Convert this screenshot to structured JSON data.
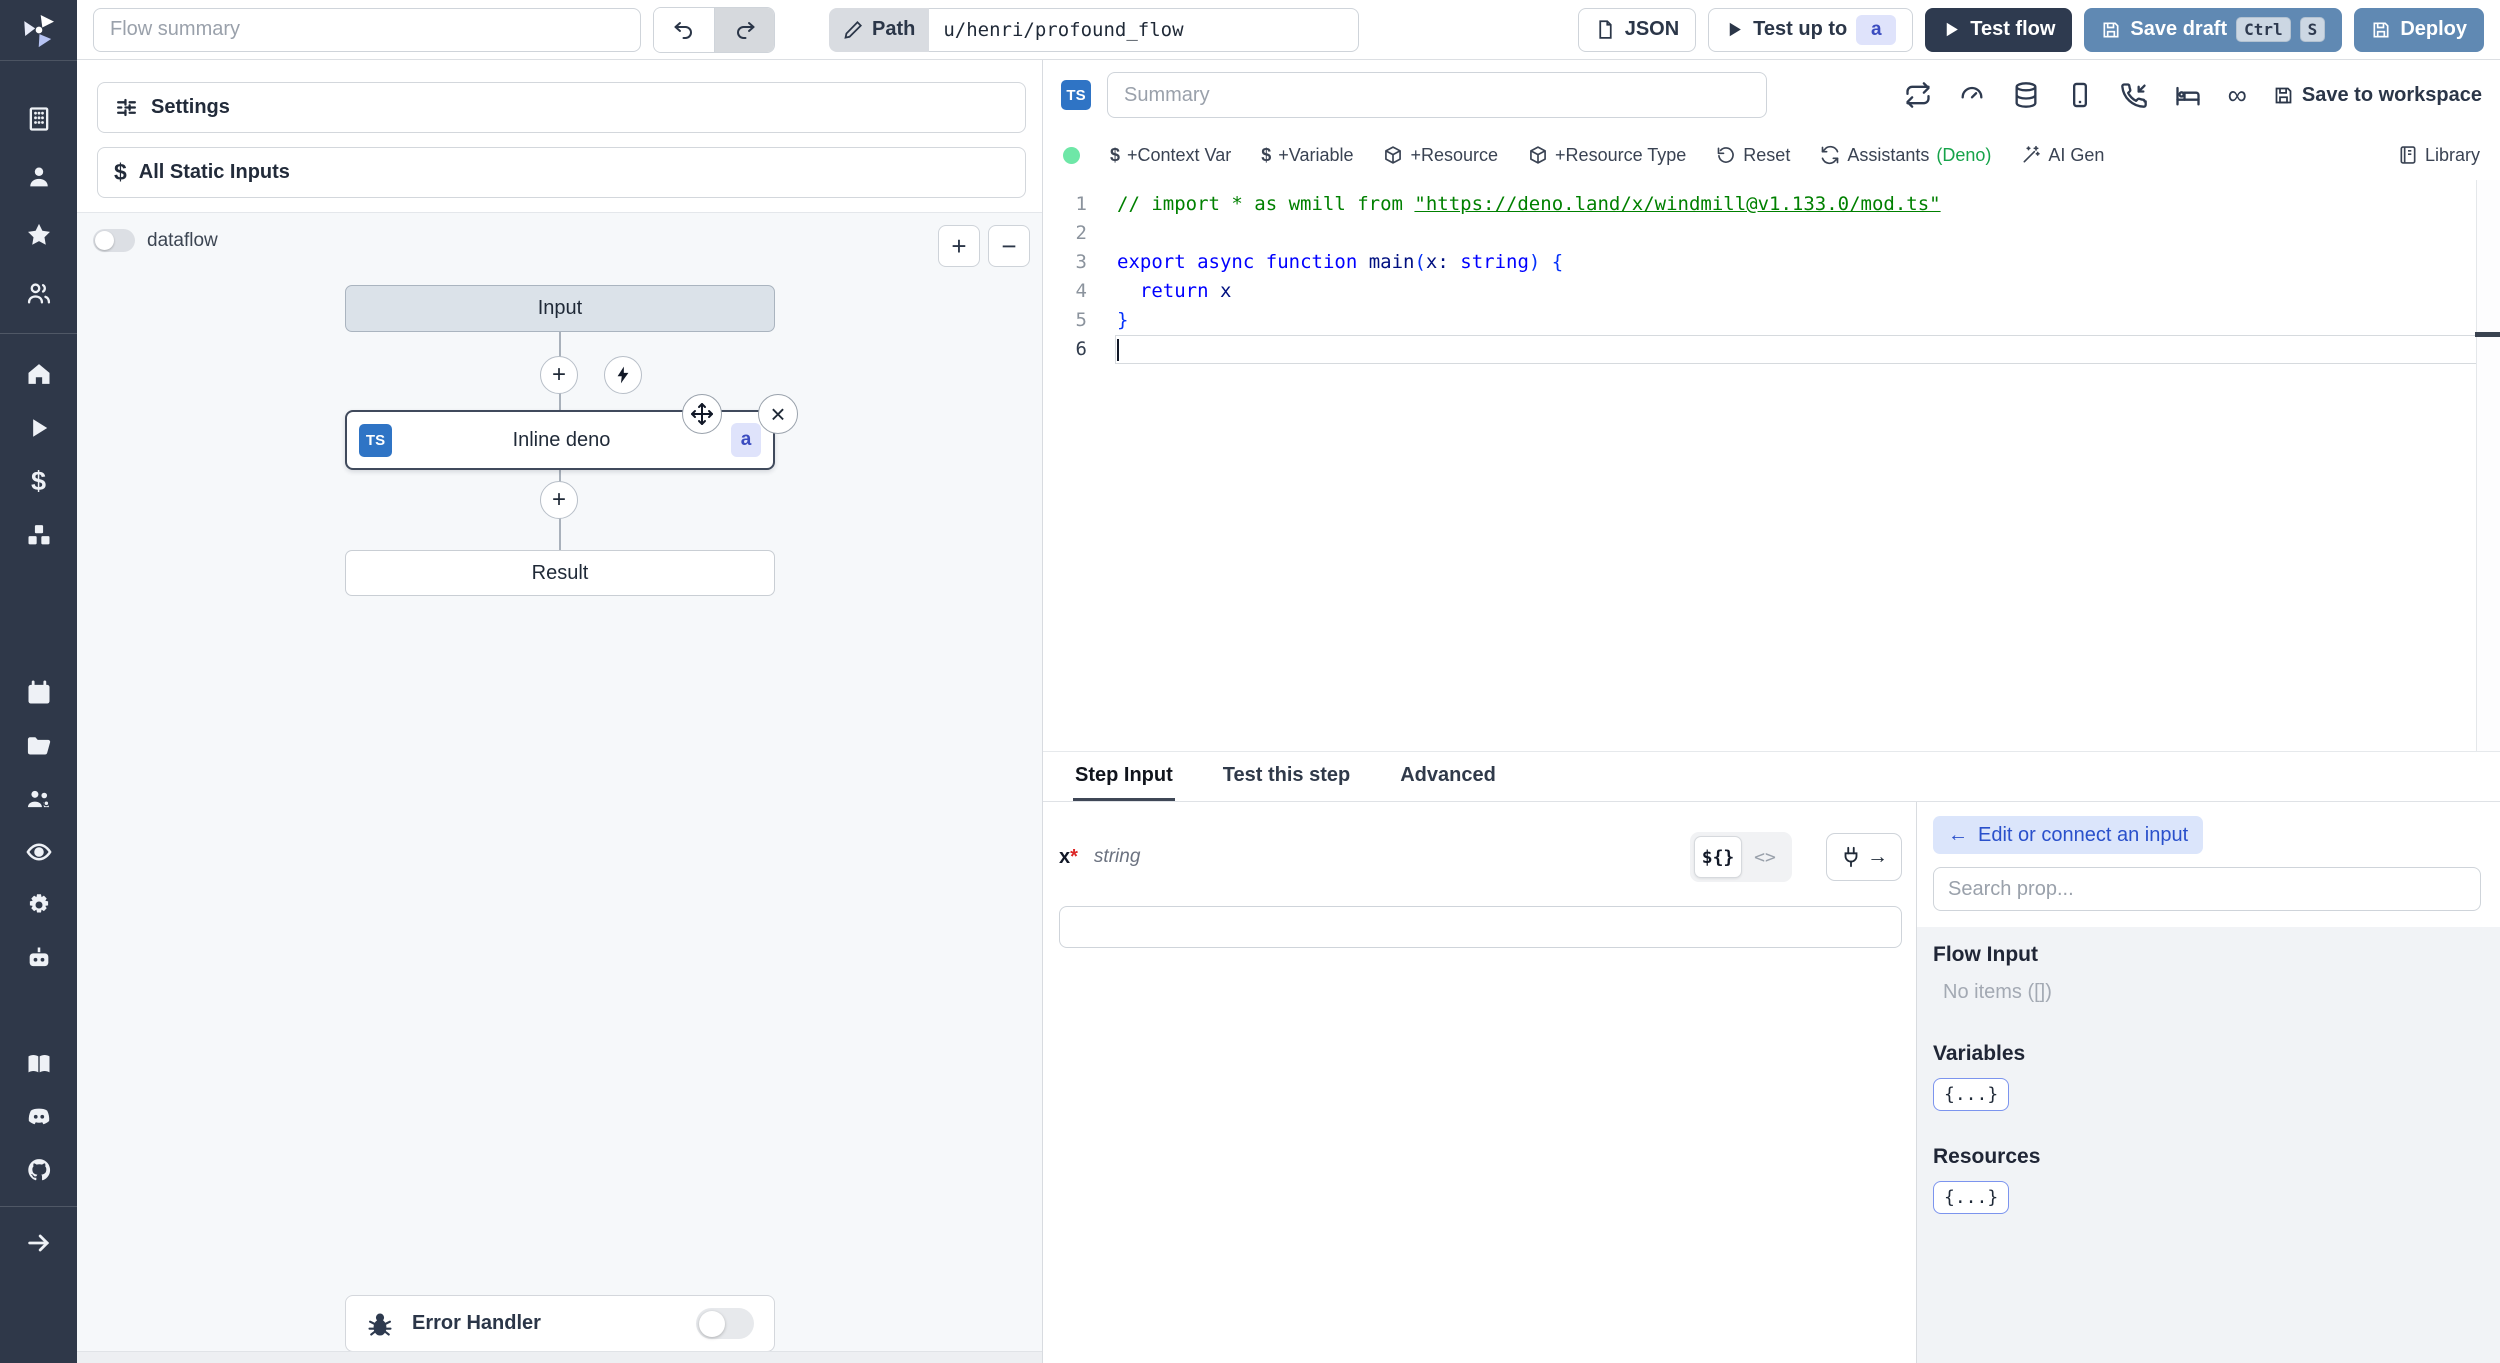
{
  "topbar": {
    "flow_summary_placeholder": "Flow summary",
    "path_label": "Path",
    "path_value": "u/henri/profound_flow",
    "json_button": "JSON",
    "test_up_to": "Test up to",
    "test_up_to_step": "a",
    "test_flow": "Test flow",
    "save_draft": "Save draft",
    "save_draft_kbd": [
      "Ctrl",
      "S"
    ],
    "deploy": "Deploy"
  },
  "sidebar": {
    "icons": [
      "windmill-logo",
      "building",
      "user",
      "star",
      "users",
      "home",
      "play",
      "dollar",
      "boxes",
      "calendar",
      "folder",
      "users-gear",
      "eye",
      "gear",
      "bot",
      "book",
      "discord",
      "github",
      "arrow-right"
    ]
  },
  "flow_panel": {
    "settings": "Settings",
    "all_static_inputs": "All Static Inputs",
    "dataflow": "dataflow",
    "zoom_in": "+",
    "zoom_out": "−",
    "graph": {
      "input_node": "Input",
      "step_node": {
        "lang_badge": "TS",
        "label": "Inline deno",
        "id_badge": "a"
      },
      "result_node": "Result"
    },
    "error_handler": "Error Handler"
  },
  "editor": {
    "lang_badge": "TS",
    "summary_placeholder": "Summary",
    "save_to_workspace": "Save to workspace",
    "toolbar": {
      "context_var": "+Context Var",
      "variable": "+Variable",
      "resource": "+Resource",
      "resource_type": "+Resource Type",
      "reset": "Reset",
      "assistants": "Assistants",
      "assistants_lang": "(Deno)",
      "ai_gen": "AI Gen",
      "library": "Library"
    },
    "code": {
      "lines": [
        {
          "n": "1",
          "tokens": [
            {
              "cls": "comment",
              "text": "// import * as wmill from "
            },
            {
              "cls": "comment link",
              "text": "\"https://deno.land/x/windmill@v1.133.0/mod.ts\""
            }
          ]
        },
        {
          "n": "2",
          "tokens": []
        },
        {
          "n": "3",
          "tokens": [
            {
              "cls": "kw",
              "text": "export"
            },
            {
              "cls": "plain",
              "text": " "
            },
            {
              "cls": "kw",
              "text": "async"
            },
            {
              "cls": "plain",
              "text": " "
            },
            {
              "cls": "kw",
              "text": "function"
            },
            {
              "cls": "plain",
              "text": " main"
            },
            {
              "cls": "paren",
              "text": "("
            },
            {
              "cls": "plain",
              "text": "x: "
            },
            {
              "cls": "kw",
              "text": "string"
            },
            {
              "cls": "paren",
              "text": ") {"
            }
          ]
        },
        {
          "n": "4",
          "tokens": [
            {
              "cls": "plain",
              "text": "  "
            },
            {
              "cls": "kw",
              "text": "return"
            },
            {
              "cls": "plain",
              "text": " x"
            }
          ]
        },
        {
          "n": "5",
          "tokens": [
            {
              "cls": "paren",
              "text": "}"
            }
          ]
        },
        {
          "n": "6",
          "tokens": [],
          "current": true
        }
      ]
    }
  },
  "step_panel": {
    "tabs": [
      "Step Input",
      "Test this step",
      "Advanced"
    ],
    "active_tab": "Step Input",
    "arg": {
      "name": "x",
      "required": "*",
      "type": "string",
      "value": ""
    },
    "expr_toggle": "${}",
    "code_toggle": "<>",
    "plug_arrow": "→"
  },
  "prop_panel": {
    "edit_arrow": "←",
    "edit_button": "Edit or connect an input",
    "search_placeholder": "Search prop...",
    "flow_input_title": "Flow Input",
    "flow_input_empty": "No items ([])",
    "variables_title": "Variables",
    "variables_chip": "{...}",
    "resources_title": "Resources",
    "resources_chip": "{...}"
  },
  "colors": {
    "sidebar_bg": "#2f3849",
    "accent_steel_blue": "#6089b3",
    "dark_navy": "#2e3a4f",
    "badge_indigo_bg": "#dfe3fb",
    "badge_indigo_text": "#3b4cc0",
    "green_dot": "#6ee7a7",
    "deno_green": "#16a34a",
    "ts_badge_blue": "#2f74c5",
    "code_keyword": "#0000ff",
    "code_comment": "#008000"
  }
}
